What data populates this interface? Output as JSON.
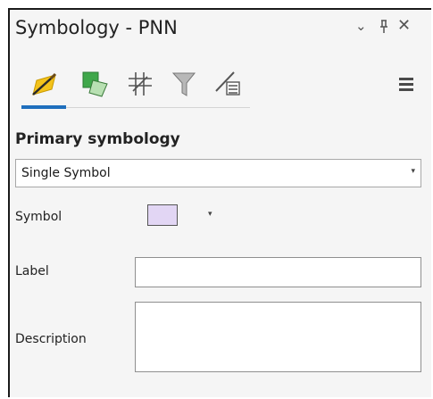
{
  "panel": {
    "title": "Symbology - PNN",
    "controls": {
      "menu": "⌄",
      "pin": "ꟸ",
      "close": "✕"
    }
  },
  "tool_tabs": [
    {
      "icon": "paint-brush-icon",
      "active": true
    },
    {
      "icon": "layer-overlay-icon",
      "active": false
    },
    {
      "icon": "grid-hash-icon",
      "active": false
    },
    {
      "icon": "funnel-filter-icon",
      "active": false
    },
    {
      "icon": "brush-list-icon",
      "active": false
    }
  ],
  "primary_symbology": {
    "heading": "Primary symbology",
    "selected": "Single Symbol"
  },
  "symbol": {
    "label": "Symbol",
    "fill_color": "#e2d6f4"
  },
  "label_field": {
    "label": "Label",
    "value": ""
  },
  "description_field": {
    "label": "Description",
    "value": ""
  },
  "colors": {
    "accent": "#1f6fbd"
  }
}
